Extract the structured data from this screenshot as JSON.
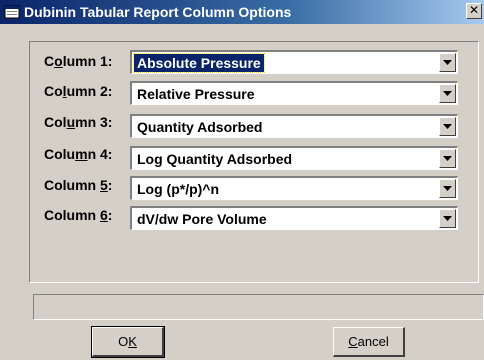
{
  "window": {
    "title": "Dubinin Tabular Report Column Options",
    "close_glyph": "✕"
  },
  "columns": [
    {
      "label_pre": "C",
      "label_accel": "o",
      "label_post": "lumn 1:",
      "value": "Absolute Pressure",
      "selected": true
    },
    {
      "label_pre": "Co",
      "label_accel": "l",
      "label_post": "umn 2:",
      "value": "Relative Pressure",
      "selected": false
    },
    {
      "label_pre": "Col",
      "label_accel": "u",
      "label_post": "mn 3:",
      "value": "Quantity Adsorbed",
      "selected": false
    },
    {
      "label_pre": "Colu",
      "label_accel": "m",
      "label_post": "n 4:",
      "value": "Log Quantity Adsorbed",
      "selected": false
    },
    {
      "label_pre": "Column ",
      "label_accel": "5",
      "label_post": ":",
      "value": "Log (p*/p)^n",
      "selected": false
    },
    {
      "label_pre": "Column ",
      "label_accel": "6",
      "label_post": ":",
      "value": "dV/dw Pore Volume",
      "selected": false
    }
  ],
  "status": {
    "text": ""
  },
  "buttons": {
    "ok_pre": "O",
    "ok_accel": "K",
    "ok_post": "",
    "cancel_pre": "",
    "cancel_accel": "C",
    "cancel_post": "ancel"
  },
  "icons": {
    "title_icon": "window-app-icon",
    "close": "close-icon",
    "dropdown": "chevron-down-icon"
  },
  "colors": {
    "title_bar_start": "#0a246a",
    "title_bar_end": "#a6caf0",
    "face": "#d4d0c8",
    "selection": "#0a246a"
  }
}
